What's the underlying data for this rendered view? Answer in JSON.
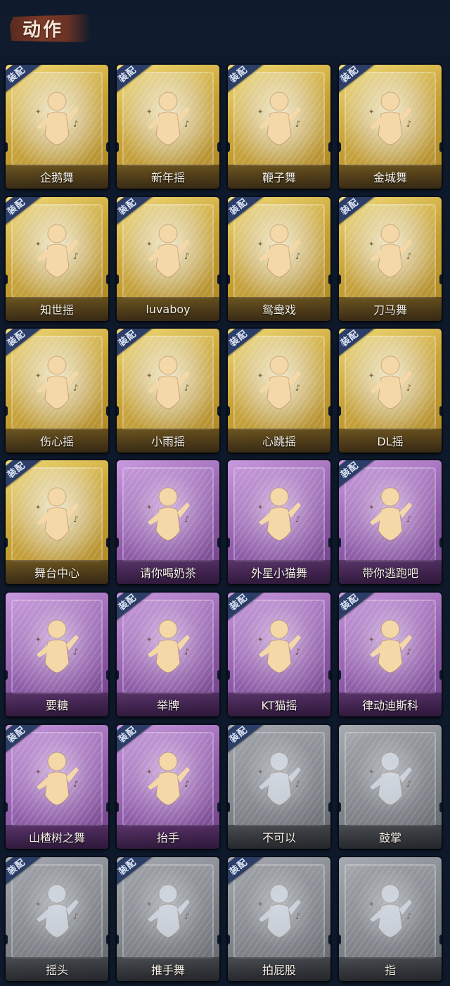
{
  "section_title": "动作",
  "equip_label": "装配",
  "colors": {
    "background": "#0e1a2c",
    "gold": "#c9a336",
    "purple": "#8e5aa8",
    "gray": "#7d8187",
    "equip_badge": "#2c3e68",
    "figure_unlocked": "#f5d8a8",
    "figure_locked": "#d8e0ea"
  },
  "cards": [
    {
      "label": "企鹅舞",
      "tier": "gold",
      "equipped": true,
      "icon": "dancer-figure-icon"
    },
    {
      "label": "新年摇",
      "tier": "gold",
      "equipped": true,
      "icon": "dancer-figure-icon"
    },
    {
      "label": "鞭子舞",
      "tier": "gold",
      "equipped": true,
      "icon": "dancer-figure-icon"
    },
    {
      "label": "金城舞",
      "tier": "gold",
      "equipped": true,
      "icon": "dancer-figure-icon"
    },
    {
      "label": "知世摇",
      "tier": "gold",
      "equipped": true,
      "icon": "dancer-figure-icon"
    },
    {
      "label": "luvaboy",
      "tier": "gold",
      "equipped": true,
      "icon": "dancer-figure-icon"
    },
    {
      "label": "鸳鸯戏",
      "tier": "gold",
      "equipped": true,
      "icon": "dancer-figure-icon"
    },
    {
      "label": "刀马舞",
      "tier": "gold",
      "equipped": true,
      "icon": "dancer-figure-icon"
    },
    {
      "label": "伤心摇",
      "tier": "gold",
      "equipped": true,
      "icon": "heart-hands-figure-icon"
    },
    {
      "label": "小雨摇",
      "tier": "gold",
      "equipped": true,
      "icon": "dancer-figure-icon"
    },
    {
      "label": "心跳摇",
      "tier": "gold",
      "equipped": true,
      "icon": "dancer-figure-icon"
    },
    {
      "label": "DL摇",
      "tier": "gold",
      "equipped": true,
      "icon": "dancer-figure-icon"
    },
    {
      "label": "舞台中心",
      "tier": "gold",
      "equipped": true,
      "icon": "dancer-figure-icon"
    },
    {
      "label": "请你喝奶茶",
      "tier": "purple",
      "equipped": false,
      "icon": "sign-holder-figure-icon"
    },
    {
      "label": "外星小猫舞",
      "tier": "purple",
      "equipped": false,
      "icon": "dancer-figure-icon"
    },
    {
      "label": "带你逃跑吧",
      "tier": "purple",
      "equipped": true,
      "icon": "dancer-figure-icon"
    },
    {
      "label": "要糖",
      "tier": "purple",
      "equipped": false,
      "icon": "beckon-figure-icon"
    },
    {
      "label": "举牌",
      "tier": "purple",
      "equipped": true,
      "icon": "sign-holder-figure-icon"
    },
    {
      "label": "KT猫摇",
      "tier": "purple",
      "equipped": true,
      "icon": "dancer-figure-icon"
    },
    {
      "label": "律动迪斯科",
      "tier": "purple",
      "equipped": true,
      "icon": "disco-figure-icon"
    },
    {
      "label": "山楂树之舞",
      "tier": "purple",
      "equipped": true,
      "icon": "dancer-figure-icon"
    },
    {
      "label": "抬手",
      "tier": "purple",
      "equipped": true,
      "icon": "raise-hand-figure-icon"
    },
    {
      "label": "不可以",
      "tier": "gray",
      "equipped": true,
      "icon": "finger-wag-icon"
    },
    {
      "label": "鼓掌",
      "tier": "gray",
      "equipped": false,
      "icon": "clap-hands-icon"
    },
    {
      "label": "摇头",
      "tier": "gray",
      "equipped": true,
      "icon": "shake-head-figure-icon"
    },
    {
      "label": "推手舞",
      "tier": "gray",
      "equipped": true,
      "icon": "push-hands-figure-icon"
    },
    {
      "label": "拍屁股",
      "tier": "gray",
      "equipped": true,
      "icon": "butt-pat-figure-icon"
    },
    {
      "label": "指",
      "tier": "gray",
      "equipped": false,
      "icon": "point-hand-icon"
    }
  ]
}
